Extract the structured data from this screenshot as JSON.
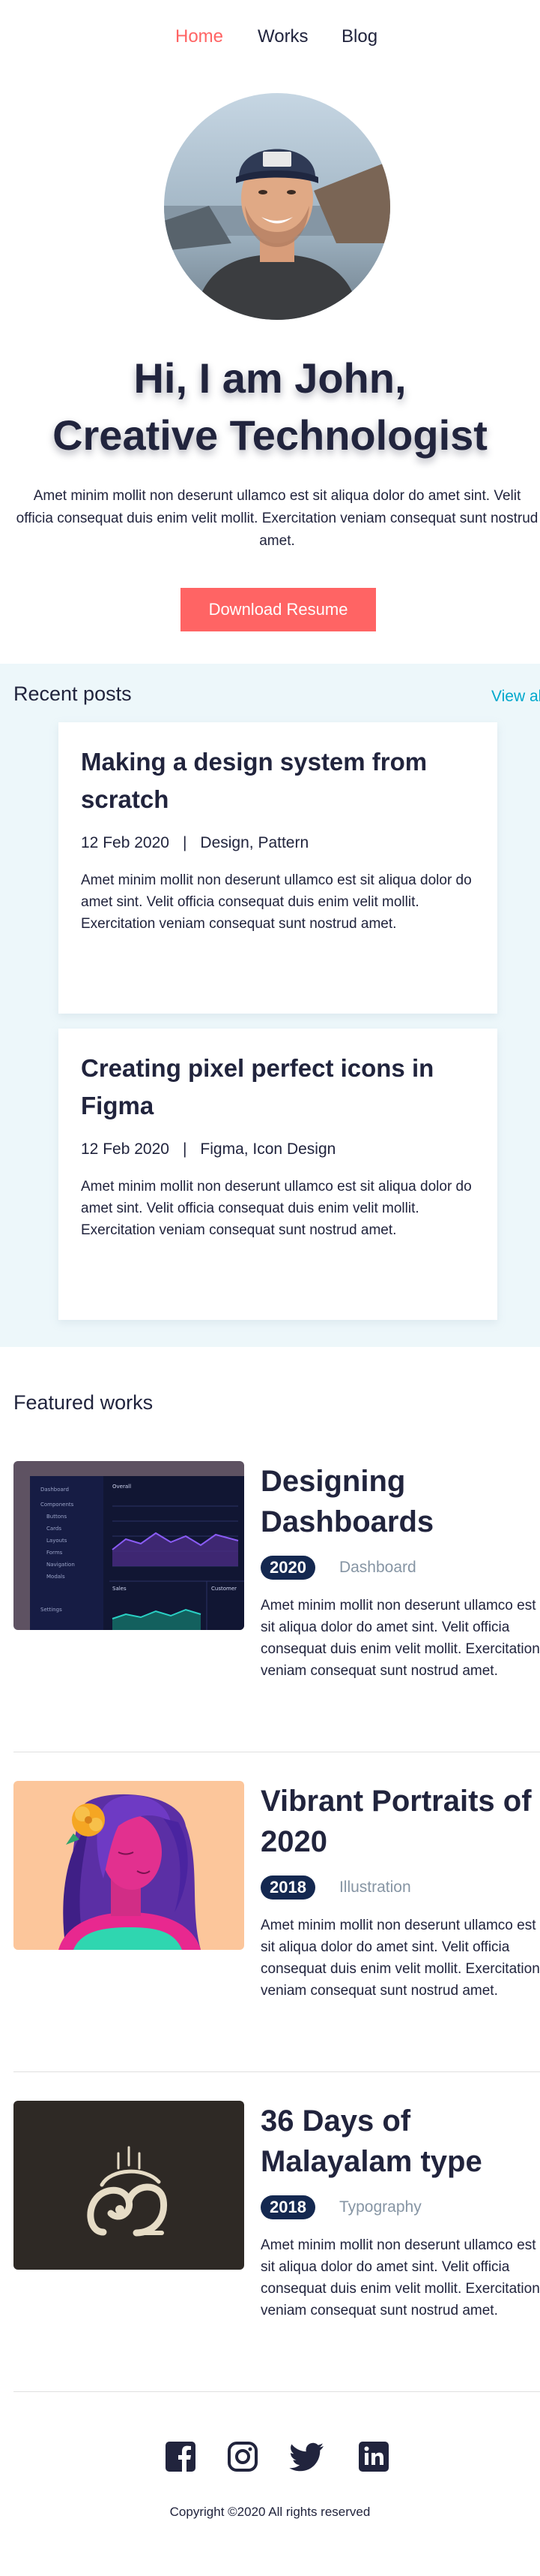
{
  "nav": {
    "items": [
      {
        "label": "Home",
        "active": true
      },
      {
        "label": "Works",
        "active": false
      },
      {
        "label": "Blog",
        "active": false
      }
    ]
  },
  "hero": {
    "title_line1": "Hi, I am John,",
    "title_line2": "Creative Technologist",
    "description": "Amet minim mollit non deserunt ullamco est sit aliqua dolor do amet sint. Velit officia consequat duis enim velit mollit. Exercitation veniam consequat sunt nostrud amet.",
    "button_label": "Download Resume"
  },
  "recent_posts": {
    "title": "Recent posts",
    "view_all": "View all",
    "posts": [
      {
        "title": "Making a design system from scratch",
        "date": "12 Feb 2020",
        "separator": "|",
        "tags": "Design, Pattern",
        "excerpt": "Amet minim mollit non deserunt ullamco est sit aliqua dolor do amet sint. Velit officia consequat duis enim velit mollit. Exercitation veniam consequat sunt nostrud amet."
      },
      {
        "title": "Creating pixel perfect icons in Figma",
        "date": "12 Feb 2020",
        "separator": "|",
        "tags": "Figma, Icon Design",
        "excerpt": "Amet minim mollit non deserunt ullamco est sit aliqua dolor do amet sint. Velit officia consequat duis enim velit mollit. Exercitation veniam consequat sunt nostrud amet."
      }
    ]
  },
  "featured_works": {
    "title": "Featured works",
    "works": [
      {
        "title": "Designing Dashboards",
        "year": "2020",
        "category": "Dashboard",
        "description": "Amet minim mollit non deserunt ullamco est sit aliqua dolor do amet sint. Velit officia consequat duis enim velit mollit. Exercitation veniam consequat sunt nostrud amet.",
        "thumb_menu": [
          "Dashboard",
          "Components",
          "Buttons",
          "Cards",
          "Layouts",
          "Forms",
          "Navigation",
          "Modals",
          "Settings"
        ],
        "thumb_panels": [
          "Overall",
          "Sales",
          "Customer"
        ]
      },
      {
        "title": "Vibrant Portraits of 2020",
        "year": "2018",
        "category": "Illustration",
        "description": "Amet minim mollit non deserunt ullamco est sit aliqua dolor do amet sint. Velit officia consequat duis enim velit mollit. Exercitation veniam consequat sunt nostrud amet."
      },
      {
        "title": "36 Days of Malayalam type",
        "year": "2018",
        "category": "Typography",
        "description": "Amet minim mollit non deserunt ullamco est sit aliqua dolor do amet sint. Velit officia consequat duis enim velit mollit. Exercitation veniam consequat sunt nostrud amet."
      }
    ]
  },
  "footer": {
    "social": [
      {
        "icon": "facebook-icon"
      },
      {
        "icon": "instagram-icon"
      },
      {
        "icon": "twitter-icon"
      },
      {
        "icon": "linkedin-icon"
      }
    ],
    "copyright": "Copyright ©2020 All rights reserved"
  },
  "colors": {
    "accent": "#ff6464",
    "text": "#21243d",
    "link": "#00a8cc",
    "badge": "#142850",
    "muted": "#8695a4",
    "section_bg": "#edf7fa"
  }
}
